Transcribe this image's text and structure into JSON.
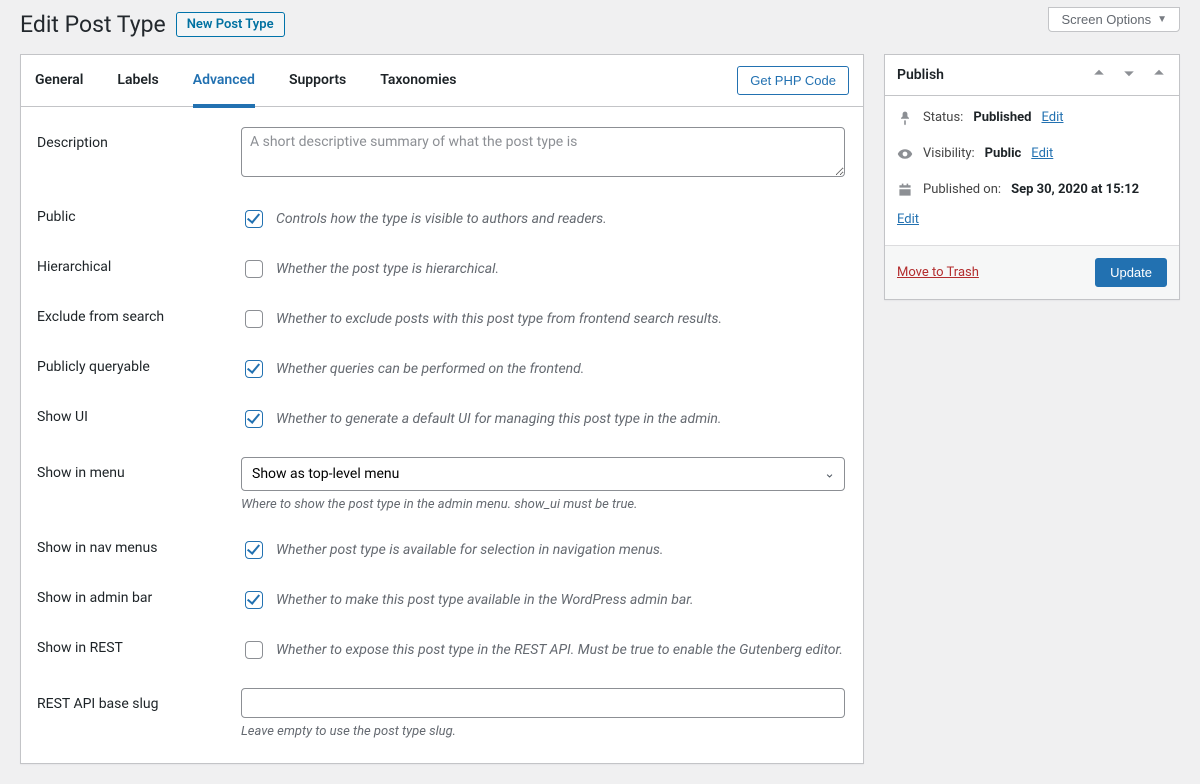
{
  "header": {
    "title": "Edit Post Type",
    "new_button": "New Post Type",
    "screen_options": "Screen Options"
  },
  "tabs": {
    "general": "General",
    "labels": "Labels",
    "advanced": "Advanced",
    "supports": "Supports",
    "taxonomies": "Taxonomies",
    "get_php": "Get PHP Code"
  },
  "fields": {
    "description": {
      "label": "Description",
      "placeholder": "A short descriptive summary of what the post type is",
      "value": ""
    },
    "public": {
      "label": "Public",
      "hint": "Controls how the type is visible to authors and readers.",
      "checked": true
    },
    "hierarchical": {
      "label": "Hierarchical",
      "hint": "Whether the post type is hierarchical.",
      "checked": false
    },
    "exclude_from_search": {
      "label": "Exclude from search",
      "hint": "Whether to exclude posts with this post type from frontend search results.",
      "checked": false
    },
    "publicly_queryable": {
      "label": "Publicly queryable",
      "hint": "Whether queries can be performed on the frontend.",
      "checked": true
    },
    "show_ui": {
      "label": "Show UI",
      "hint": "Whether to generate a default UI for managing this post type in the admin.",
      "checked": true
    },
    "show_in_menu": {
      "label": "Show in menu",
      "selected": "Show as top-level menu",
      "hint": "Where to show the post type in the admin menu. show_ui must be true."
    },
    "show_in_nav_menus": {
      "label": "Show in nav menus",
      "hint": "Whether post type is available for selection in navigation menus.",
      "checked": true
    },
    "show_in_admin_bar": {
      "label": "Show in admin bar",
      "hint": "Whether to make this post type available in the WordPress admin bar.",
      "checked": true
    },
    "show_in_rest": {
      "label": "Show in REST",
      "hint": "Whether to expose this post type in the REST API. Must be true to enable the Gutenberg editor.",
      "checked": false
    },
    "rest_base": {
      "label": "REST API base slug",
      "value": "",
      "hint": "Leave empty to use the post type slug."
    }
  },
  "publish": {
    "title": "Publish",
    "status_label": "Status:",
    "status_value": "Published",
    "visibility_label": "Visibility:",
    "visibility_value": "Public",
    "published_label": "Published on:",
    "published_value": "Sep 30, 2020 at 15:12",
    "edit": "Edit",
    "trash": "Move to Trash",
    "update": "Update"
  }
}
